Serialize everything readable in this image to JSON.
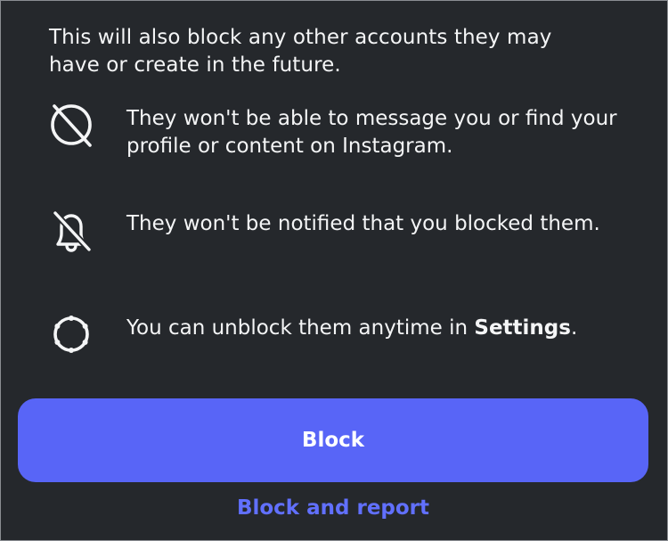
{
  "dialog": {
    "intro": "This will also block any other accounts they may have or create in the future.",
    "items": [
      {
        "icon": "blocked-message-icon",
        "text": "They won't be able to message you or find your profile or content on Instagram."
      },
      {
        "icon": "notifications-off-icon",
        "text": "They won't be notified that you blocked them."
      },
      {
        "icon": "settings-gear-icon",
        "text_before": "You can unblock them anytime in ",
        "text_bold": "Settings",
        "text_after": "."
      }
    ],
    "block_button": "Block",
    "block_and_report": "Block and report"
  },
  "colors": {
    "background": "#25282c",
    "text": "#f4f5f6",
    "primary_button": "#5865f7",
    "link": "#6170ff"
  }
}
